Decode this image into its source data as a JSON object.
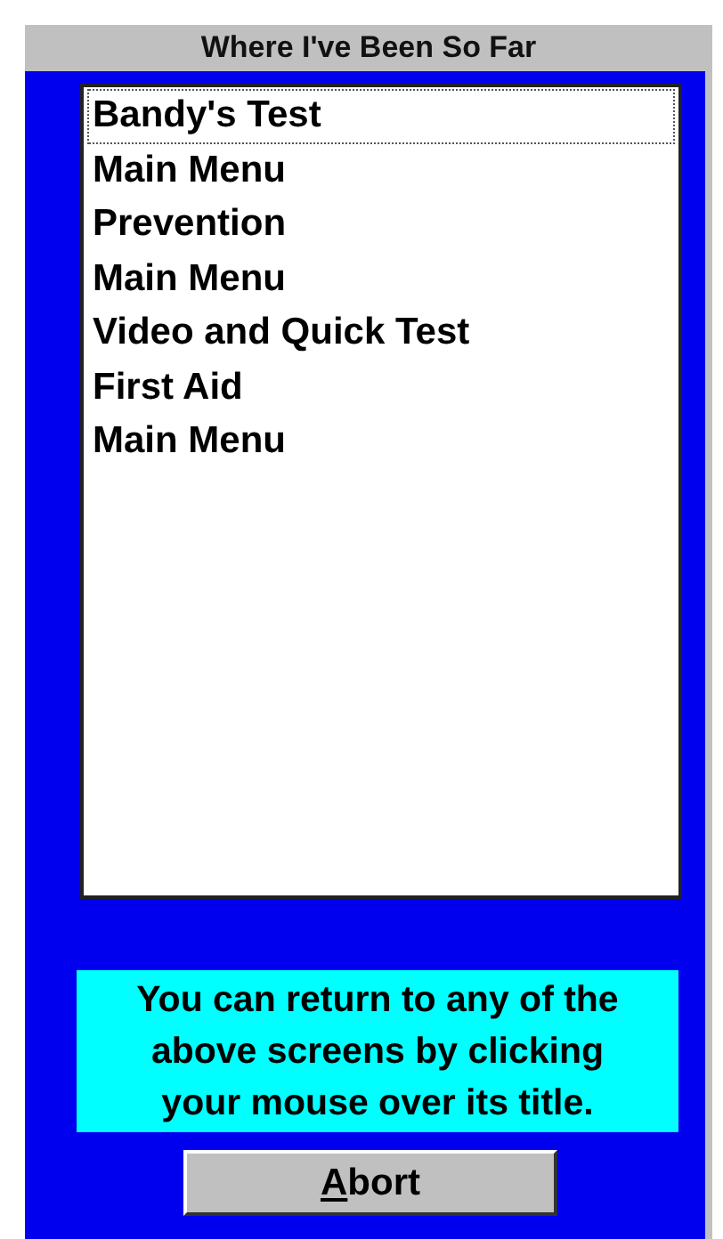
{
  "window": {
    "title": "Where I've Been So Far"
  },
  "history": [
    {
      "label": "Bandy's Test",
      "focused": true
    },
    {
      "label": "Main Menu",
      "focused": false
    },
    {
      "label": "Prevention",
      "focused": false
    },
    {
      "label": "Main Menu",
      "focused": false
    },
    {
      "label": "Video and Quick Test",
      "focused": false
    },
    {
      "label": "First Aid",
      "focused": false
    },
    {
      "label": "Main Menu",
      "focused": false
    }
  ],
  "note": "You can return to any of the above screens by clicking your mouse over its title.",
  "buttons": [
    {
      "label": "Abort",
      "mnemonic_underlined": true
    }
  ]
}
